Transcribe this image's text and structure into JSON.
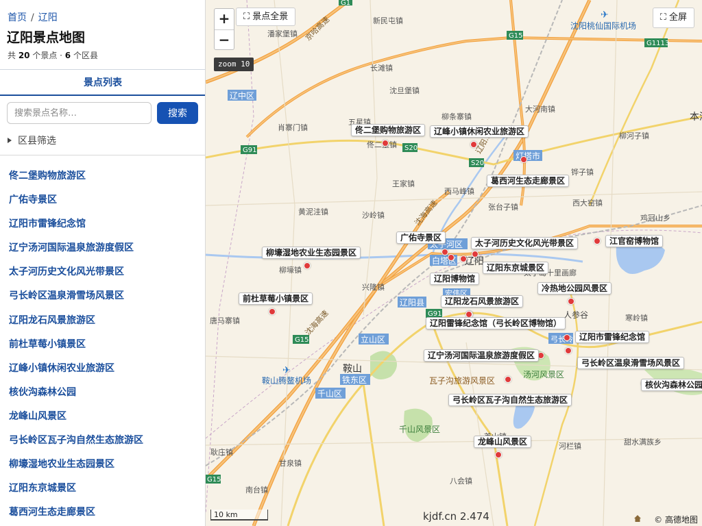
{
  "breadcrumb": {
    "home": "首页",
    "separator": "/",
    "current": "辽阳"
  },
  "page_title": "辽阳景点地图",
  "stats": {
    "prefix": "共 ",
    "spot_count": "20",
    "spot_suffix": " 个景点 · ",
    "district_count": "6",
    "district_suffix": " 个区县"
  },
  "tab_label": "景点列表",
  "search": {
    "placeholder": "搜索景点名称…",
    "button": "搜索"
  },
  "filter_label": "区县筛选",
  "spot_list": [
    "佟二堡购物旅游区",
    "广佑寺景区",
    "辽阳市雷锋纪念馆",
    "辽宁汤河国际温泉旅游度假区",
    "太子河历史文化风光带景区",
    "弓长岭区温泉滑雪场风景区",
    "辽阳龙石风景旅游区",
    "前杜草莓小镇景区",
    "辽峰小镇休闲农业旅游区",
    "核伙沟森林公园",
    "龙峰山风景区",
    "弓长岭区瓦子沟自然生态旅游区",
    "柳壕湿地农业生态园景区",
    "辽阳东京城景区",
    "葛西河生态走廊景区"
  ],
  "map": {
    "controls": {
      "zoom_in": "+",
      "zoom_out": "−",
      "full_extent": "景点全景",
      "fullscreen": "全屏",
      "zoom_level": "zoom 10"
    },
    "scale": "10 km",
    "watermark": "kjdf.cn 2.474",
    "copyright": "© 高德地图",
    "pins": [
      {
        "name": "佟二堡购物旅游区"
      },
      {
        "name": "辽峰小镇休闲农业旅游区"
      },
      {
        "name": "葛西河生态走廊景区"
      },
      {
        "name": "广佑寺景区"
      },
      {
        "name": "太子河历史文化风光带景区"
      },
      {
        "name": "江官窑博物馆"
      },
      {
        "name": "柳壕湿地农业生态园景区"
      },
      {
        "name": "辽阳东京城景区"
      },
      {
        "name": "辽阳博物馆"
      },
      {
        "name": "冷热地公园风景区"
      },
      {
        "name": "前杜草莓小镇景区"
      },
      {
        "name": "辽阳龙石风景旅游区"
      },
      {
        "name": "辽阳雷锋纪念馆（弓长岭区博物馆）"
      },
      {
        "name": "辽阳市雷锋纪念馆"
      },
      {
        "name": "辽宁汤河国际温泉旅游度假区"
      },
      {
        "name": "弓长岭区温泉滑雪场风景区"
      },
      {
        "name": "核伙沟森林公园"
      },
      {
        "name": "弓长岭区瓦子沟自然生态旅游区"
      },
      {
        "name": "龙峰山风景区"
      }
    ],
    "place_labels": [
      "新民屯镇",
      "潘家堡镇",
      "长滩镇",
      "沈旦堡镇",
      "五星镇",
      "肖寨门镇",
      "柳条寨镇",
      "大河南镇",
      "柳河子镇",
      "本溪",
      "王家镇",
      "西马峰镇",
      "佟二堡镇",
      "铧子镇",
      "沙岭镇",
      "黄泥洼镇",
      "张台子镇",
      "西大窑镇",
      "鸡冠山乡",
      "柳壕镇",
      "兴隆镇",
      "唐马寨镇",
      "寒岭镇",
      "鞍山",
      "千山风景区",
      "汤河风景区",
      "瓦子沟旅游风景区",
      "河栏镇",
      "甜水满族乡",
      "耿庄镇",
      "甘泉镇",
      "南台镇",
      "八会镇",
      "首山镇",
      "人参谷",
      "辽阳",
      "太子岛十里画廊"
    ],
    "district_badges": [
      "辽中区",
      "灯塔市",
      "太子河区",
      "白塔区",
      "宏伟区",
      "辽阳县",
      "立山区",
      "铁东区",
      "千山区",
      "弓长岭区"
    ],
    "airports": [
      "沈阳桃仙国际机场",
      "鞍山腾鳌机场"
    ],
    "road_shields": [
      "G1",
      "G15",
      "G1113",
      "G91",
      "S20",
      "S20",
      "G15",
      "G15",
      "G91"
    ],
    "road_names": [
      "京哈高速",
      "沈海高速",
      "沈海高速",
      "辽阳..."
    ]
  }
}
